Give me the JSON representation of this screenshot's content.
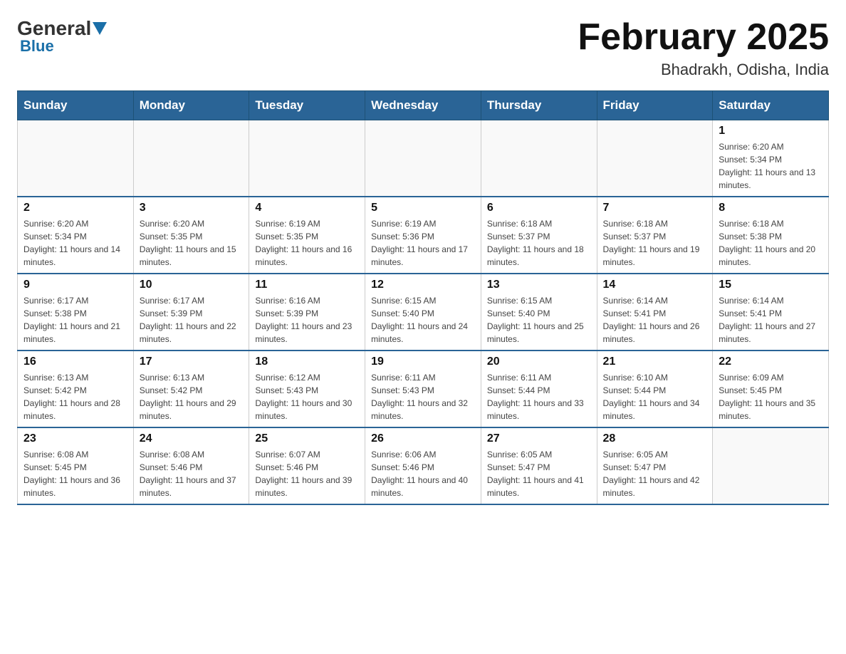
{
  "header": {
    "logo_general": "General",
    "logo_blue": "Blue",
    "title": "February 2025",
    "subtitle": "Bhadrakh, Odisha, India"
  },
  "weekdays": [
    "Sunday",
    "Monday",
    "Tuesday",
    "Wednesday",
    "Thursday",
    "Friday",
    "Saturday"
  ],
  "weeks": [
    [
      {
        "day": "",
        "sunrise": "",
        "sunset": "",
        "daylight": ""
      },
      {
        "day": "",
        "sunrise": "",
        "sunset": "",
        "daylight": ""
      },
      {
        "day": "",
        "sunrise": "",
        "sunset": "",
        "daylight": ""
      },
      {
        "day": "",
        "sunrise": "",
        "sunset": "",
        "daylight": ""
      },
      {
        "day": "",
        "sunrise": "",
        "sunset": "",
        "daylight": ""
      },
      {
        "day": "",
        "sunrise": "",
        "sunset": "",
        "daylight": ""
      },
      {
        "day": "1",
        "sunrise": "Sunrise: 6:20 AM",
        "sunset": "Sunset: 5:34 PM",
        "daylight": "Daylight: 11 hours and 13 minutes."
      }
    ],
    [
      {
        "day": "2",
        "sunrise": "Sunrise: 6:20 AM",
        "sunset": "Sunset: 5:34 PM",
        "daylight": "Daylight: 11 hours and 14 minutes."
      },
      {
        "day": "3",
        "sunrise": "Sunrise: 6:20 AM",
        "sunset": "Sunset: 5:35 PM",
        "daylight": "Daylight: 11 hours and 15 minutes."
      },
      {
        "day": "4",
        "sunrise": "Sunrise: 6:19 AM",
        "sunset": "Sunset: 5:35 PM",
        "daylight": "Daylight: 11 hours and 16 minutes."
      },
      {
        "day": "5",
        "sunrise": "Sunrise: 6:19 AM",
        "sunset": "Sunset: 5:36 PM",
        "daylight": "Daylight: 11 hours and 17 minutes."
      },
      {
        "day": "6",
        "sunrise": "Sunrise: 6:18 AM",
        "sunset": "Sunset: 5:37 PM",
        "daylight": "Daylight: 11 hours and 18 minutes."
      },
      {
        "day": "7",
        "sunrise": "Sunrise: 6:18 AM",
        "sunset": "Sunset: 5:37 PM",
        "daylight": "Daylight: 11 hours and 19 minutes."
      },
      {
        "day": "8",
        "sunrise": "Sunrise: 6:18 AM",
        "sunset": "Sunset: 5:38 PM",
        "daylight": "Daylight: 11 hours and 20 minutes."
      }
    ],
    [
      {
        "day": "9",
        "sunrise": "Sunrise: 6:17 AM",
        "sunset": "Sunset: 5:38 PM",
        "daylight": "Daylight: 11 hours and 21 minutes."
      },
      {
        "day": "10",
        "sunrise": "Sunrise: 6:17 AM",
        "sunset": "Sunset: 5:39 PM",
        "daylight": "Daylight: 11 hours and 22 minutes."
      },
      {
        "day": "11",
        "sunrise": "Sunrise: 6:16 AM",
        "sunset": "Sunset: 5:39 PM",
        "daylight": "Daylight: 11 hours and 23 minutes."
      },
      {
        "day": "12",
        "sunrise": "Sunrise: 6:15 AM",
        "sunset": "Sunset: 5:40 PM",
        "daylight": "Daylight: 11 hours and 24 minutes."
      },
      {
        "day": "13",
        "sunrise": "Sunrise: 6:15 AM",
        "sunset": "Sunset: 5:40 PM",
        "daylight": "Daylight: 11 hours and 25 minutes."
      },
      {
        "day": "14",
        "sunrise": "Sunrise: 6:14 AM",
        "sunset": "Sunset: 5:41 PM",
        "daylight": "Daylight: 11 hours and 26 minutes."
      },
      {
        "day": "15",
        "sunrise": "Sunrise: 6:14 AM",
        "sunset": "Sunset: 5:41 PM",
        "daylight": "Daylight: 11 hours and 27 minutes."
      }
    ],
    [
      {
        "day": "16",
        "sunrise": "Sunrise: 6:13 AM",
        "sunset": "Sunset: 5:42 PM",
        "daylight": "Daylight: 11 hours and 28 minutes."
      },
      {
        "day": "17",
        "sunrise": "Sunrise: 6:13 AM",
        "sunset": "Sunset: 5:42 PM",
        "daylight": "Daylight: 11 hours and 29 minutes."
      },
      {
        "day": "18",
        "sunrise": "Sunrise: 6:12 AM",
        "sunset": "Sunset: 5:43 PM",
        "daylight": "Daylight: 11 hours and 30 minutes."
      },
      {
        "day": "19",
        "sunrise": "Sunrise: 6:11 AM",
        "sunset": "Sunset: 5:43 PM",
        "daylight": "Daylight: 11 hours and 32 minutes."
      },
      {
        "day": "20",
        "sunrise": "Sunrise: 6:11 AM",
        "sunset": "Sunset: 5:44 PM",
        "daylight": "Daylight: 11 hours and 33 minutes."
      },
      {
        "day": "21",
        "sunrise": "Sunrise: 6:10 AM",
        "sunset": "Sunset: 5:44 PM",
        "daylight": "Daylight: 11 hours and 34 minutes."
      },
      {
        "day": "22",
        "sunrise": "Sunrise: 6:09 AM",
        "sunset": "Sunset: 5:45 PM",
        "daylight": "Daylight: 11 hours and 35 minutes."
      }
    ],
    [
      {
        "day": "23",
        "sunrise": "Sunrise: 6:08 AM",
        "sunset": "Sunset: 5:45 PM",
        "daylight": "Daylight: 11 hours and 36 minutes."
      },
      {
        "day": "24",
        "sunrise": "Sunrise: 6:08 AM",
        "sunset": "Sunset: 5:46 PM",
        "daylight": "Daylight: 11 hours and 37 minutes."
      },
      {
        "day": "25",
        "sunrise": "Sunrise: 6:07 AM",
        "sunset": "Sunset: 5:46 PM",
        "daylight": "Daylight: 11 hours and 39 minutes."
      },
      {
        "day": "26",
        "sunrise": "Sunrise: 6:06 AM",
        "sunset": "Sunset: 5:46 PM",
        "daylight": "Daylight: 11 hours and 40 minutes."
      },
      {
        "day": "27",
        "sunrise": "Sunrise: 6:05 AM",
        "sunset": "Sunset: 5:47 PM",
        "daylight": "Daylight: 11 hours and 41 minutes."
      },
      {
        "day": "28",
        "sunrise": "Sunrise: 6:05 AM",
        "sunset": "Sunset: 5:47 PM",
        "daylight": "Daylight: 11 hours and 42 minutes."
      },
      {
        "day": "",
        "sunrise": "",
        "sunset": "",
        "daylight": ""
      }
    ]
  ]
}
